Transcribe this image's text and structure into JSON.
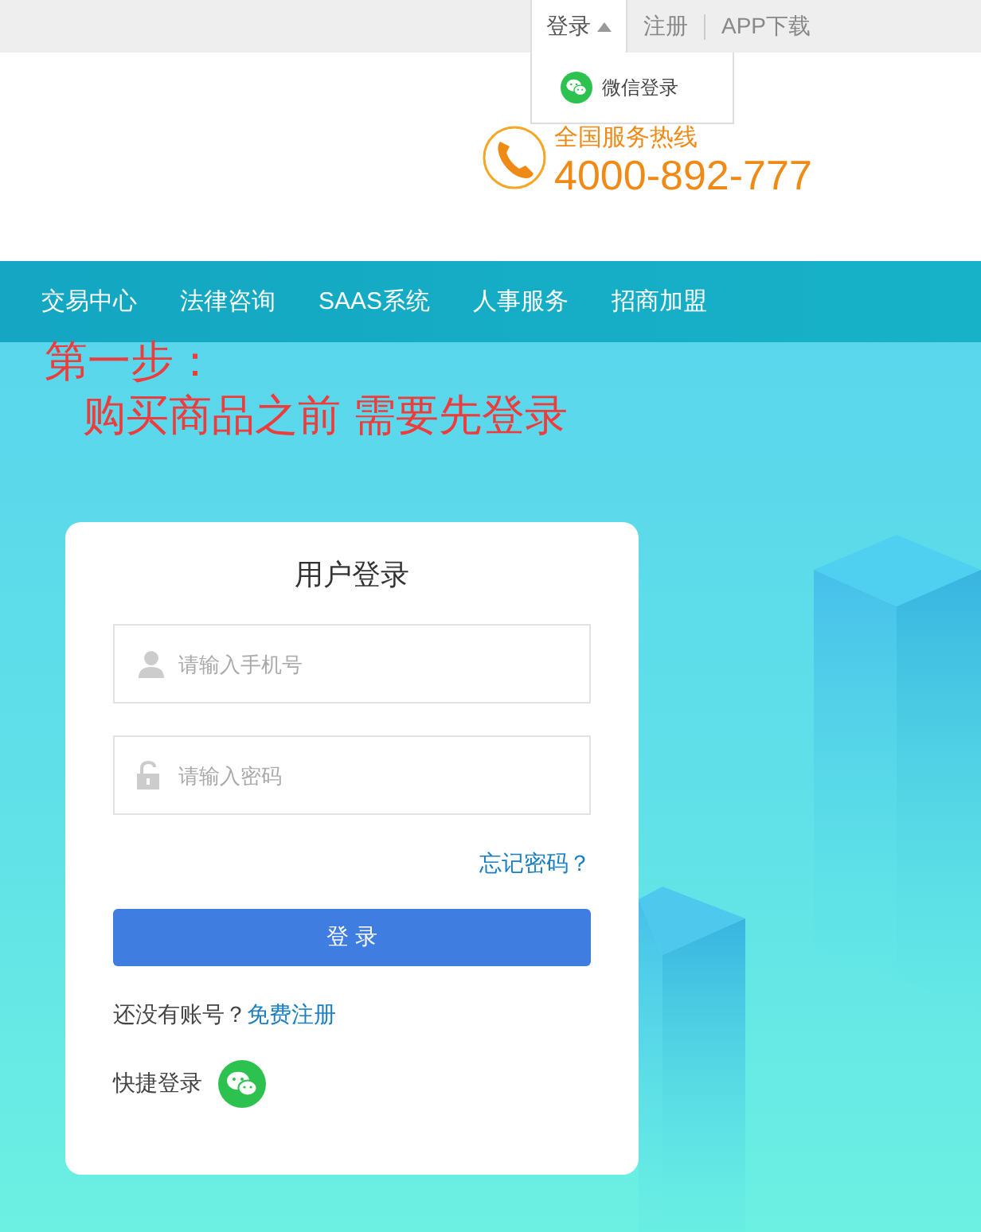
{
  "top_bar": {
    "items": [
      {
        "label": "登录",
        "expanded": true
      },
      {
        "label": "注册",
        "expanded": false
      },
      {
        "label": "APP下载",
        "expanded": false
      }
    ],
    "dropdown": {
      "items": [
        {
          "label": "微信登录"
        }
      ]
    }
  },
  "header": {
    "hotline": {
      "title": "全国服务热线",
      "number": "4000-892-777"
    }
  },
  "nav": {
    "items": [
      "交易中心",
      "法律咨询",
      "SAAS系统",
      "人事服务",
      "招商加盟"
    ]
  },
  "annotation": {
    "lines": [
      "第一步：",
      "购买商品之前 需要先登录"
    ]
  },
  "login_card": {
    "title": "用户登录",
    "fields": [
      {
        "kind": "phone",
        "placeholder": "请输入手机号"
      },
      {
        "kind": "password",
        "placeholder": "请输入密码"
      }
    ],
    "forgot_link": "忘记密码？",
    "submit_button": "登 录",
    "register_prompt": "还没有账号？",
    "register_link": "免费注册",
    "quick_login": "快捷登录"
  }
}
